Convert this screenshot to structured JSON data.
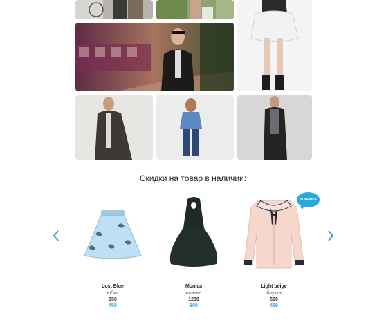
{
  "gallery": {
    "photos": [
      {
        "icon": "fashion-photo-icon"
      },
      {
        "icon": "fashion-photo-icon"
      },
      {
        "icon": "fashion-photo-icon"
      },
      {
        "icon": "fashion-photo-icon"
      },
      {
        "icon": "fashion-photo-icon"
      },
      {
        "icon": "fashion-photo-icon"
      },
      {
        "icon": "fashion-photo-icon"
      }
    ]
  },
  "sale": {
    "title": "Скидки на товар в наличии:",
    "prev_icon": "chevron-left-icon",
    "next_icon": "chevron-right-icon",
    "accent_color": "#29a8e0",
    "products": [
      {
        "name": "Lost Blue",
        "type": "юбка",
        "old_price": "950",
        "new_price": "459"
      },
      {
        "name": "Monica",
        "type": "платье",
        "old_price": "1200",
        "new_price": "800"
      },
      {
        "name": "Light beige",
        "type": "блузка",
        "old_price": "500",
        "new_price": "459",
        "badge": "НОВИНКА"
      }
    ]
  }
}
